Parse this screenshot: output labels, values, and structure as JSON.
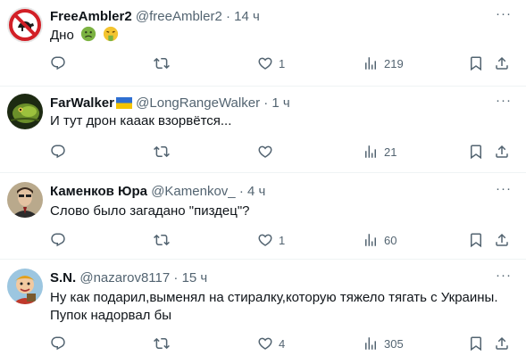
{
  "tweets": [
    {
      "name": "FreeAmbler2",
      "handle": "@freeAmbler2",
      "separator": "·",
      "time": "14 ч",
      "text": "Дно",
      "emoji_icons": [
        "nauseated-face-icon",
        "vomiting-face-icon"
      ],
      "avatar_icon": "no-entry-sign-avatar",
      "stats": {
        "replies": "",
        "retweets": "",
        "likes": "1",
        "views": "219"
      }
    },
    {
      "name": "FarWalker",
      "name_badge_icon": "ukraine-flag-icon",
      "handle": "@LongRangeWalker",
      "separator": "·",
      "time": "1 ч",
      "text": "И тут дрон кааак взорвётся...",
      "avatar_icon": "snake-avatar",
      "stats": {
        "replies": "",
        "retweets": "",
        "likes": "",
        "views": "21"
      }
    },
    {
      "name": "Каменков Юра",
      "handle": "@Kamenkov_",
      "separator": "·",
      "time": "4 ч",
      "text": "Слово было загадано \"пиздец\"?",
      "avatar_icon": "man-portrait-avatar",
      "stats": {
        "replies": "",
        "retweets": "",
        "likes": "1",
        "views": "60"
      }
    },
    {
      "name": "S.N.",
      "handle": "@nazarov8117",
      "separator": "·",
      "time": "15 ч",
      "text_lines": [
        "Ну как подарил,выменял на стиралку,которую тяжело тягать с Украины.",
        "Пупок надорвал бы"
      ],
      "avatar_icon": "cartoon-character-avatar",
      "stats": {
        "replies": "",
        "retweets": "",
        "likes": "4",
        "views": "305"
      }
    }
  ],
  "colors": {
    "text": "#0f1419",
    "secondary": "#536471",
    "divider": "#eff3f4"
  }
}
